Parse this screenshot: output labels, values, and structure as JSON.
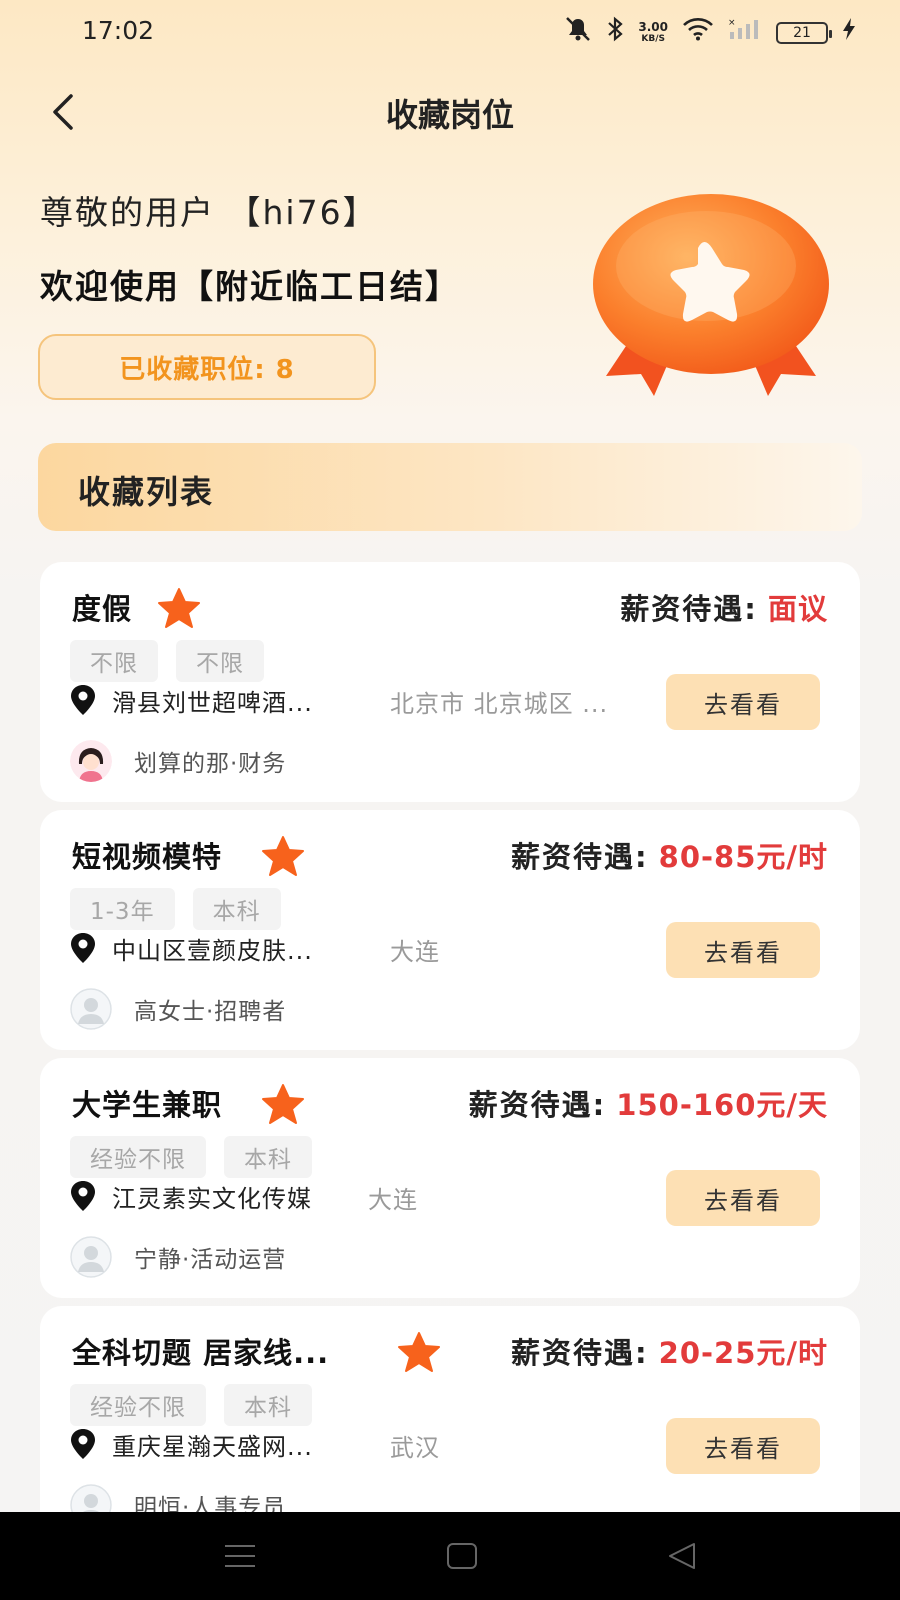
{
  "status": {
    "time": "17:02",
    "net_speed_top": "3.00",
    "net_speed_bottom": "KB/S",
    "battery": "21"
  },
  "header": {
    "title": "收藏岗位"
  },
  "user": {
    "greeting": "尊敬的用户 【hi76】",
    "welcome": "欢迎使用【附近临工日结】",
    "saved_count": "已收藏职位: 8"
  },
  "list": {
    "title": "收藏列表",
    "salary_label": "薪资待遇:",
    "view_label": "去看看",
    "jobs": [
      {
        "title": "度假",
        "salary": "面议",
        "tags": [
          "不限",
          "不限"
        ],
        "company": "滑县刘世超啤酒...",
        "city": "北京市 北京城区 ...",
        "recruiter": "划算的那·财务",
        "avatar": "female-avatar"
      },
      {
        "title": "短视频模特",
        "salary": "80-85元/时",
        "tags": [
          "1-3年",
          "本科"
        ],
        "company": "中山区壹颜皮肤...",
        "city": "大连",
        "recruiter": "高女士·招聘者",
        "avatar": "default-avatar"
      },
      {
        "title": "大学生兼职",
        "salary": "150-160元/天",
        "tags": [
          "经验不限",
          "本科"
        ],
        "company": "江灵素实文化传媒",
        "city": "大连",
        "recruiter": "宁静·活动运营",
        "avatar": "default-avatar"
      },
      {
        "title": "全科切题 居家线...",
        "salary": "20-25元/时",
        "tags": [
          "经验不限",
          "本科"
        ],
        "company": "重庆星瀚天盛网...",
        "city": "武汉",
        "recruiter": "明恒·人事专员",
        "avatar": "default-avatar"
      }
    ]
  },
  "colors": {
    "accent": "#f2941e",
    "salary": "#e23b3b",
    "star": "#f7621c",
    "button": "#fde0b4"
  },
  "icons": [
    "back-arrow-icon",
    "star-icon",
    "location-pin-icon",
    "medal-icon",
    "menu-icon",
    "home-icon",
    "back-triangle-icon"
  ]
}
